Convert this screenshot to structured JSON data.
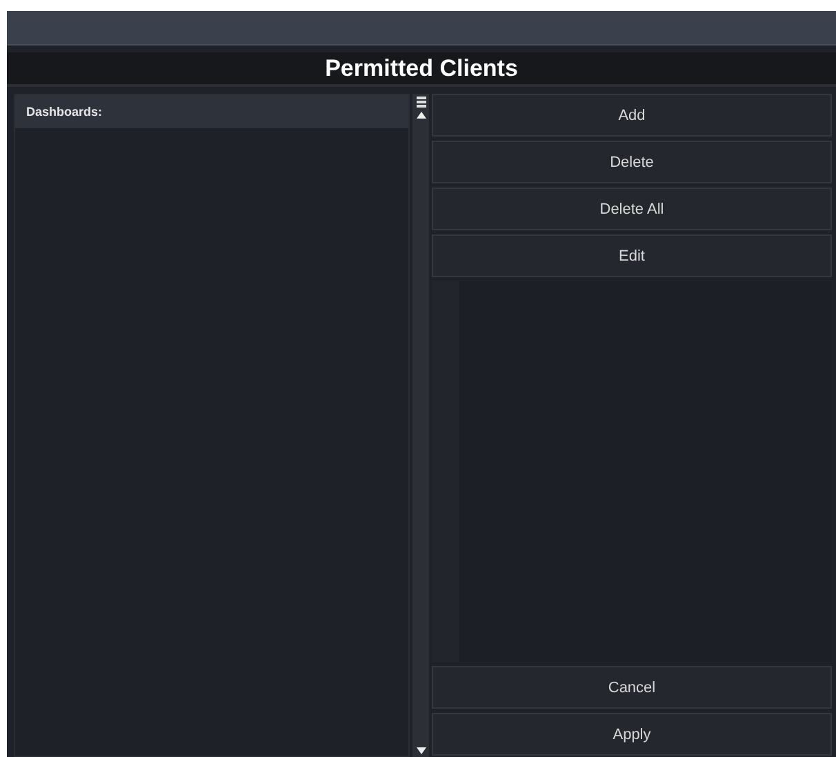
{
  "title": "Permitted Clients",
  "list": {
    "header": "Dashboards:"
  },
  "actions": [
    "Add",
    "Delete",
    "Delete All",
    "Edit"
  ],
  "footer_buttons": [
    "Cancel",
    "Apply"
  ]
}
